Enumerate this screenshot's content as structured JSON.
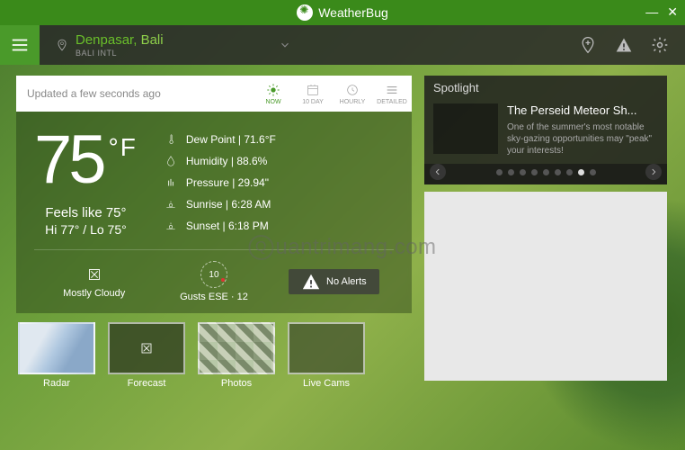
{
  "brand": {
    "name": "WeatherBug",
    "suffix": "®"
  },
  "window": {
    "minimize_icon": "minimize",
    "close_icon": "close"
  },
  "location": {
    "city": "Denpasar,",
    "region": "Bali",
    "subtitle": "BALI INTL"
  },
  "nav": {
    "add_icon": "add-location",
    "alert_icon": "alert-triangle",
    "settings_icon": "gear"
  },
  "tabbar": {
    "updated": "Updated a few seconds ago",
    "tabs": [
      {
        "id": "now",
        "label": "NOW",
        "active": true
      },
      {
        "id": "ten",
        "label": "10 DAY",
        "active": false
      },
      {
        "id": "hourly",
        "label": "HOURLY",
        "active": false
      },
      {
        "id": "detailed",
        "label": "DETAILED",
        "active": false
      }
    ]
  },
  "weather": {
    "temp_value": "75",
    "temp_unit": "°F",
    "feels_like": "Feels like 75°",
    "hi_lo": "Hi 77° / Lo 75°",
    "details": {
      "dew_point": "Dew Point  |  71.6°F",
      "humidity": "Humidity  |  88.6%",
      "pressure": "Pressure  |  29.94\"",
      "sunrise": "Sunrise  |  6:28 AM",
      "sunset": "Sunset  |  6:18 PM"
    },
    "status": {
      "condition": "Mostly Cloudy",
      "gusts_value": "10",
      "gusts_label": "Gusts ESE · 12",
      "no_alerts": "No Alerts"
    }
  },
  "thumbnails": [
    {
      "id": "radar",
      "label": "Radar"
    },
    {
      "id": "forecast",
      "label": "Forecast"
    },
    {
      "id": "photos",
      "label": "Photos"
    },
    {
      "id": "livecams",
      "label": "Live Cams"
    }
  ],
  "spotlight": {
    "heading": "Spotlight",
    "title": "The Perseid Meteor Sh...",
    "desc": "One of the summer's most notable sky-gazing opportunities may \"peak\" your interests!",
    "dot_count": 9,
    "active_dot": 7
  },
  "watermark": "uantrimang.com"
}
